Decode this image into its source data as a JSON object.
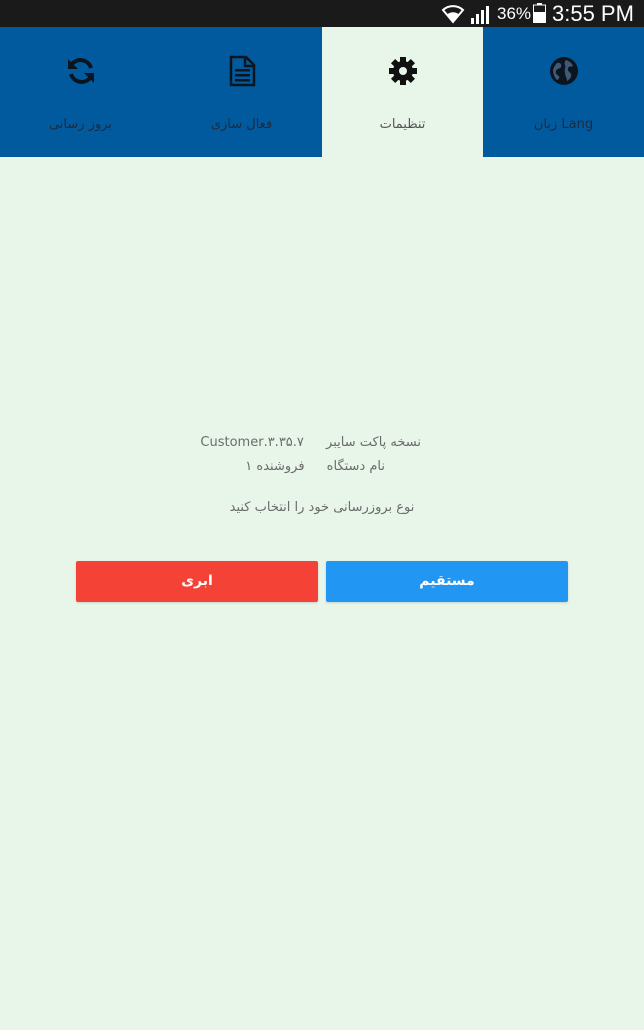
{
  "status_bar": {
    "battery_percent": "36%",
    "time": "3:55 PM"
  },
  "tabs": [
    {
      "label": "زبان Lang",
      "icon": "globe-icon",
      "active": false
    },
    {
      "label": "تنظیمات",
      "icon": "gear-icon",
      "active": true
    },
    {
      "label": "فعال سازی",
      "icon": "document-icon",
      "active": false
    },
    {
      "label": "بروز رسانی",
      "icon": "refresh-icon",
      "active": false
    }
  ],
  "info": {
    "version_label": "نسخه پاکت سایبر",
    "version_value": "۳.۳۵.۷.Customer",
    "device_label": "نام دستگاه",
    "device_value": "فروشنده ۱",
    "prompt": "نوع بروزرسانی خود را انتخاب کنید"
  },
  "buttons": {
    "direct": "مستقیم",
    "cloud": "ابری"
  },
  "colors": {
    "tab_bar": "#025a9e",
    "background": "#e8f6ea",
    "direct_button": "#2196f3",
    "cloud_button": "#f44336"
  }
}
